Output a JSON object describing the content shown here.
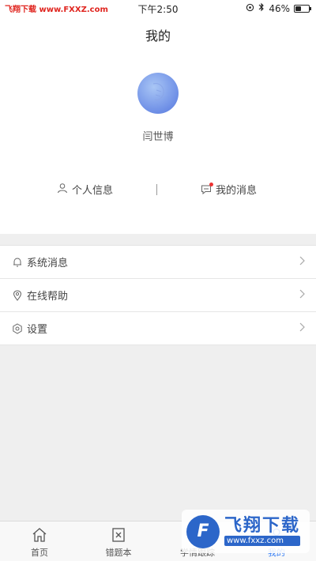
{
  "status_bar": {
    "watermark": "飞翔下载 www.FXXZ.com",
    "time": "下午2:50",
    "battery": "46%",
    "battery_level": 0.46
  },
  "header": {
    "title": "我的",
    "username": "闫世博"
  },
  "quick_links": {
    "personal_info": "个人信息",
    "my_messages": "我的消息",
    "divider": "|"
  },
  "menu": [
    {
      "label": "系统消息",
      "icon": "bell-icon"
    },
    {
      "label": "在线帮助",
      "icon": "location-pin-icon"
    },
    {
      "label": "设置",
      "icon": "gear-icon"
    }
  ],
  "tabbar": {
    "tabs": [
      {
        "label": "首页",
        "icon": "home-icon"
      },
      {
        "label": "错题本",
        "icon": "wrong-book-icon"
      },
      {
        "label": "学情跟踪",
        "icon": "tracking-icon"
      },
      {
        "label": "我的",
        "icon": "profile-icon"
      }
    ],
    "active": "我的",
    "accent": "#3b82f6"
  },
  "watermark": {
    "name": "飞翔下载",
    "url": "www.fxxz.com"
  }
}
